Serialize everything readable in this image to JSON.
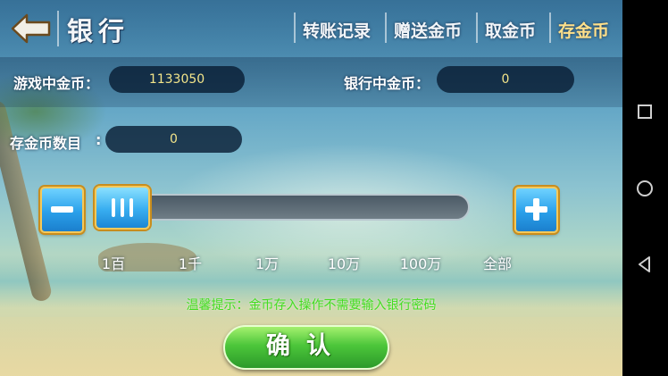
{
  "header": {
    "title": "银行",
    "tabs": [
      {
        "label": "转账记录"
      },
      {
        "label": "赠送金币"
      },
      {
        "label": "取金币"
      },
      {
        "label": "存金币",
        "active": true
      }
    ]
  },
  "fields": {
    "game_gold_label": "游戏中金币：",
    "game_gold_value": "1133050",
    "bank_gold_label": "银行中金币：",
    "bank_gold_value": "0",
    "deposit_label": "存金币数目",
    "deposit_value": "0"
  },
  "slider": {
    "level": 0,
    "ticks": [
      "1百",
      "1千",
      "1万",
      "10万",
      "100万",
      "全部"
    ]
  },
  "tip": "温馨提示：金币存入操作不需要输入银行密码",
  "confirm_label": "确认",
  "icons": {
    "back": "back-arrow-icon",
    "minus": "minus-icon",
    "plus": "plus-icon",
    "grip": "grip-icon",
    "nav_recent": "square-icon",
    "nav_home": "circle-icon",
    "nav_back": "triangle-icon"
  },
  "colors": {
    "tip_text": "#43dd20",
    "value_text": "#f3e58a",
    "active_tab": "#ffe08a",
    "confirm_green": "#4cc63a",
    "button_blue": "#2aa0ea"
  }
}
